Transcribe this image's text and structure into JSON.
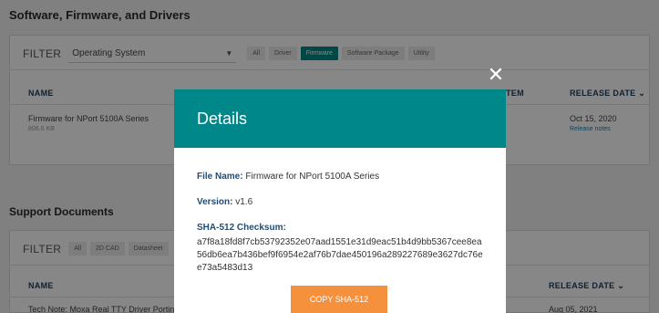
{
  "software_section": {
    "title": "Software, Firmware, and Drivers",
    "filter_label": "FILTER",
    "select_value": "Operating System",
    "chips": [
      "All",
      "Driver",
      "Firmware",
      "Software Package",
      "Utility"
    ],
    "active_chip": "Firmware",
    "columns": {
      "name": "NAME",
      "system": "TEM",
      "release": "RELEASE DATE"
    },
    "row": {
      "name": "Firmware for NPort 5100A Series",
      "size": "806.6 KB",
      "date": "Oct 15, 2020",
      "notes_link": "Release notes"
    }
  },
  "support_section": {
    "title": "Support Documents",
    "filter_label": "FILTER",
    "chips": [
      "All",
      "2D CAD",
      "Datasheet"
    ],
    "columns": {
      "name": "NAME",
      "release": "RELEASE DATE"
    },
    "row": {
      "name": "Tech Note: Moxa Real TTY Driver Portin",
      "date": "Aug 05, 2021"
    }
  },
  "modal": {
    "title": "Details",
    "file_name_label": "File Name:",
    "file_name": "Firmware for NPort 5100A Series",
    "version_label": "Version:",
    "version": "v1.6",
    "checksum_label": "SHA-512 Checksum:",
    "checksum": "a7f8a18fd8f7cb53792352e07aad1551e31d9eac51b4d9bb5367cee8ea56db6ea7b436bef9f6954e2af76b7dae450196a289227689e3627dc76ee73a5483d13",
    "copy_button": "COPY SHA-512",
    "close_glyph": "✕"
  },
  "colors": {
    "brand_teal": "#008789",
    "accent_orange": "#f5913c",
    "heading_blue": "#1d4e7a"
  }
}
